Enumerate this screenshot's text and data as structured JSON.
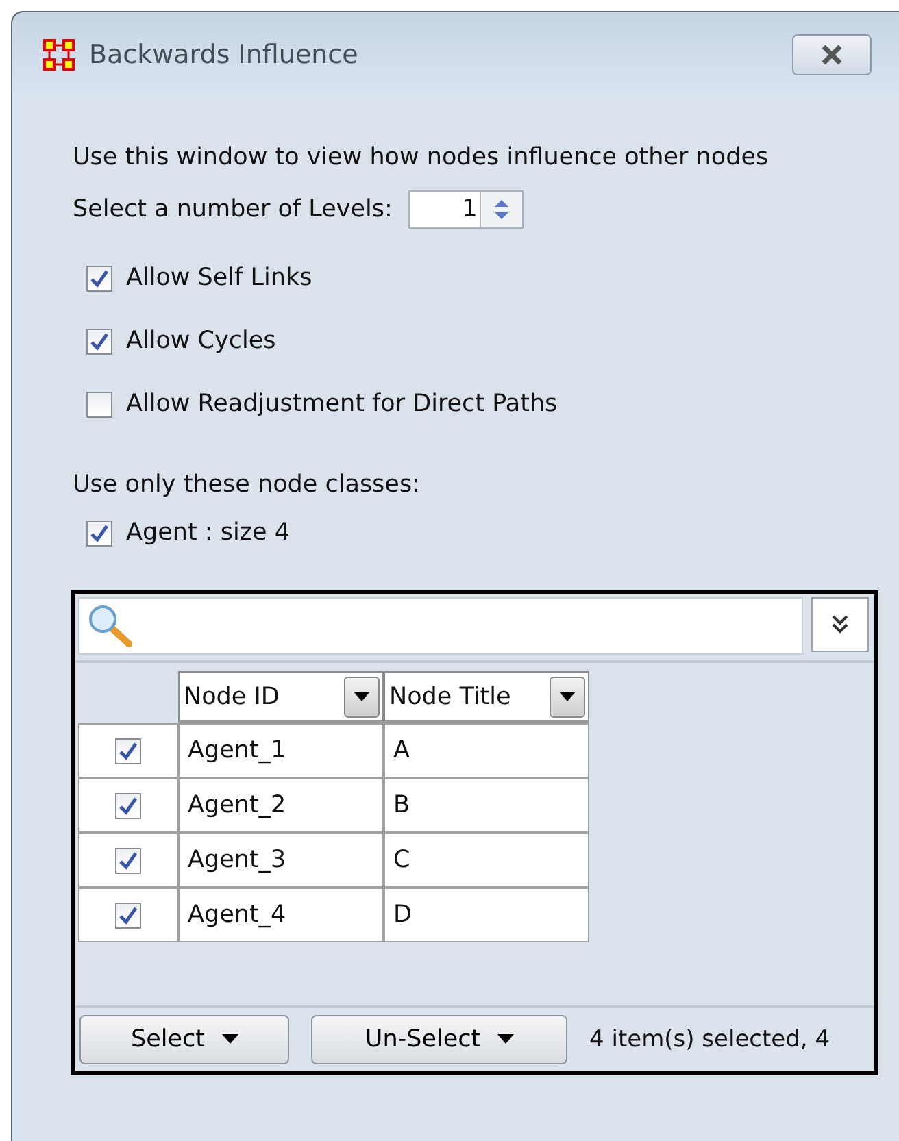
{
  "window": {
    "title": "Backwards Influence"
  },
  "intro": "Use this window to view how nodes influence other nodes",
  "levels": {
    "label": "Select a number of Levels:",
    "value": "1"
  },
  "options": [
    {
      "label": "Allow Self Links",
      "checked": true
    },
    {
      "label": "Allow Cycles",
      "checked": true
    },
    {
      "label": "Allow Readjustment for Direct Paths",
      "checked": false
    }
  ],
  "node_classes": {
    "label": "Use only these node classes:",
    "items": [
      {
        "label": "Agent : size 4",
        "checked": true
      }
    ]
  },
  "table": {
    "columns": [
      "Node ID",
      "Node Title"
    ],
    "rows": [
      {
        "checked": true,
        "cells": [
          "Agent_1",
          "A"
        ]
      },
      {
        "checked": true,
        "cells": [
          "Agent_2",
          "B"
        ]
      },
      {
        "checked": true,
        "cells": [
          "Agent_3",
          "C"
        ]
      },
      {
        "checked": true,
        "cells": [
          "Agent_4",
          "D"
        ]
      }
    ]
  },
  "buttons": [
    "Select",
    "Un-Select"
  ],
  "status": "4 item(s) selected, 4"
}
